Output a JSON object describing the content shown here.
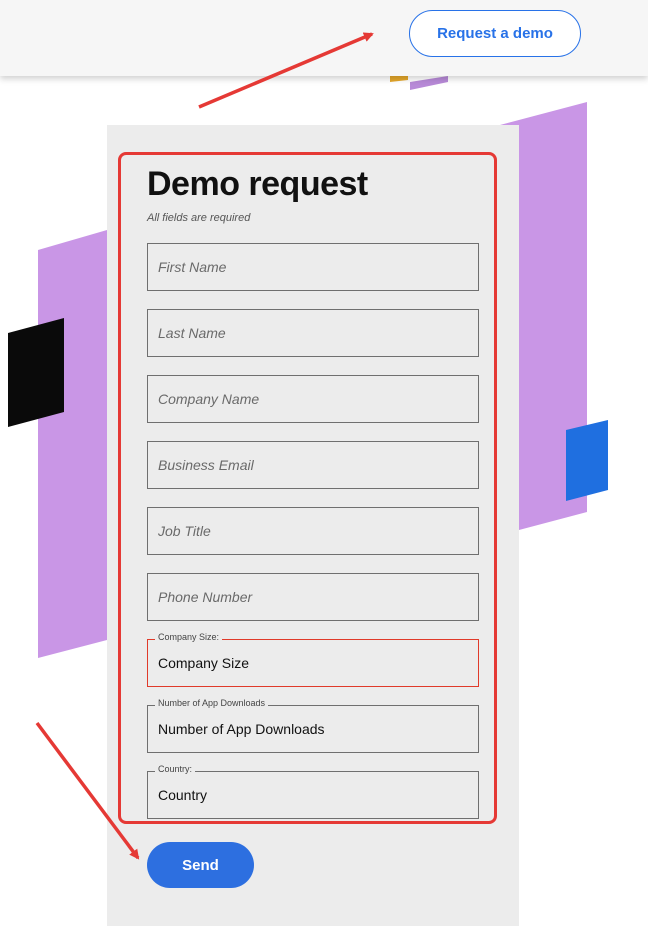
{
  "header": {
    "demo_button_label": "Request a demo"
  },
  "form": {
    "title": "Demo request",
    "subtitle": "All fields are required",
    "fields": [
      {
        "placeholder": "First Name"
      },
      {
        "placeholder": "Last Name"
      },
      {
        "placeholder": "Company Name"
      },
      {
        "placeholder": "Business Email"
      },
      {
        "placeholder": "Job Title"
      },
      {
        "placeholder": "Phone Number"
      }
    ],
    "selects": [
      {
        "legend": "Company Size:",
        "value": "Company Size"
      },
      {
        "legend": "Number of App Downloads",
        "value": "Number of App Downloads"
      },
      {
        "legend": "Country:",
        "value": "Country"
      }
    ],
    "send_label": "Send"
  },
  "colors": {
    "accent": "#2872e8",
    "highlight": "#e53935",
    "purple": "#c996e6"
  }
}
